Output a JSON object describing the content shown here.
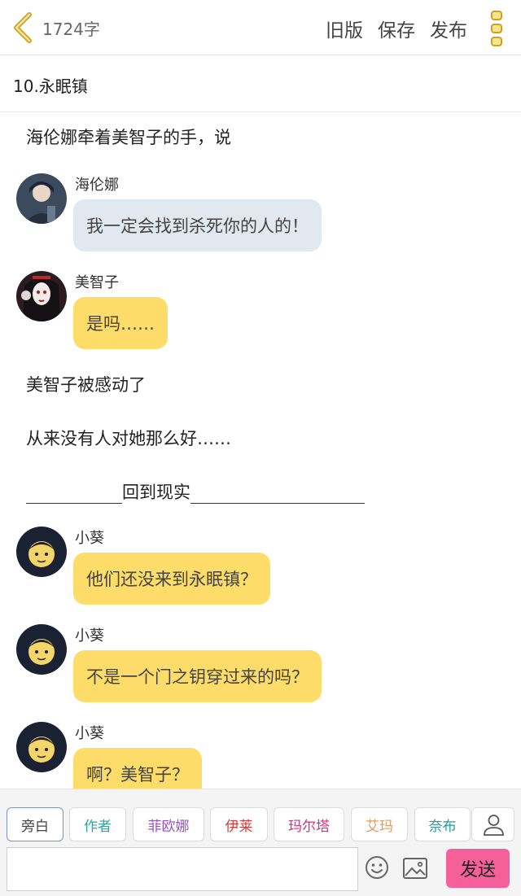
{
  "header": {
    "word_count": "1724字",
    "actions": [
      "旧版",
      "保存",
      "发布"
    ]
  },
  "chapter": {
    "title": "10.永眠镇"
  },
  "story": {
    "narration_1": "海伦娜牵着美智子的手，说",
    "msg1": {
      "name": "海伦娜",
      "text": "我一定会找到杀死你的人的！"
    },
    "msg2": {
      "name": "美智子",
      "text": "是吗……"
    },
    "narration_2": "美智子被感动了",
    "narration_3": "从来没有人对她那么好……",
    "separator": "回到现实",
    "msg3": {
      "name": "小葵",
      "text": "他们还没来到永眠镇？"
    },
    "msg4": {
      "name": "小葵",
      "text": "不是一个门之钥穿过来的吗？"
    },
    "msg5": {
      "name": "小葵",
      "text": "啊？美智子？"
    }
  },
  "characters": [
    {
      "label": "旁白",
      "color": "#444444"
    },
    {
      "label": "作者",
      "color": "#2aa8a0"
    },
    {
      "label": "菲欧娜",
      "color": "#9b4fc4"
    },
    {
      "label": "伊莱",
      "color": "#d23a3a"
    },
    {
      "label": "玛尔塔",
      "color": "#d8317c"
    },
    {
      "label": "艾玛",
      "color": "#e49a5a"
    },
    {
      "label": "奈布",
      "color": "#2a9a9a"
    }
  ],
  "composer": {
    "input_value": "",
    "send_label": "发送"
  },
  "colors": {
    "accent": "#f5609b",
    "bubble_yellow": "#fddc6a",
    "bubble_gray": "#e2e8ef",
    "icon_gold": "#c9a227"
  }
}
